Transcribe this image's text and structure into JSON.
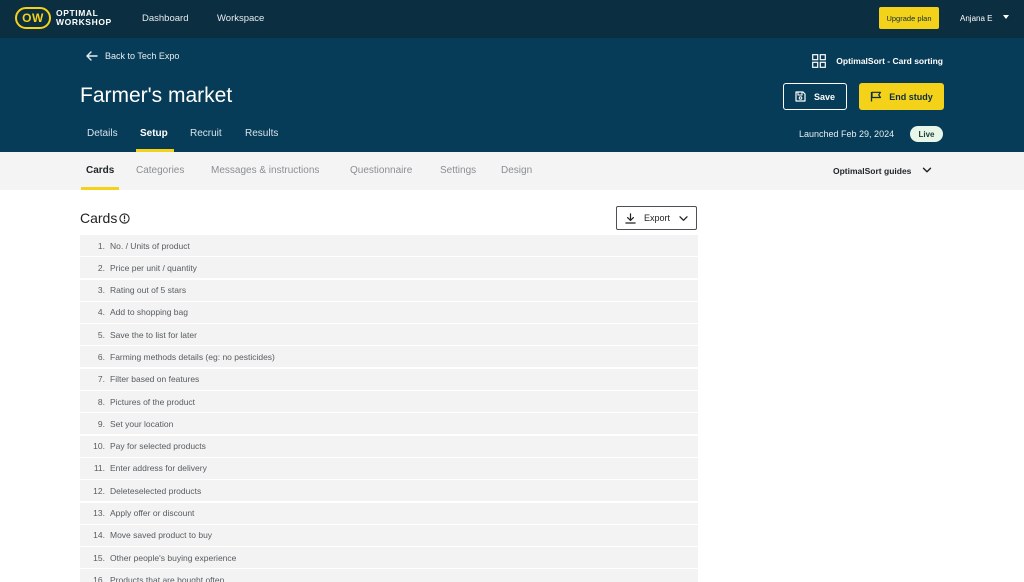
{
  "topbar": {
    "logo_mark": "OW",
    "logo_line1": "OPTIMAL",
    "logo_line2": "WORKSHOP",
    "nav": [
      "Dashboard",
      "Workspace"
    ],
    "upgrade_label": "Upgrade plan",
    "user_name": "Anjana E"
  },
  "header": {
    "back_label": "Back to Tech Expo",
    "study_type": "OptimalSort - Card sorting",
    "title": "Farmer's market",
    "save_label": "Save",
    "end_label": "End study",
    "tabs": [
      "Details",
      "Setup",
      "Recruit",
      "Results"
    ],
    "active_tab": "Setup",
    "launched": "Launched Feb 29, 2024",
    "status": "Live"
  },
  "subtabs": {
    "items": [
      "Cards",
      "Categories",
      "Messages & instructions",
      "Questionnaire",
      "Settings",
      "Design"
    ],
    "active": "Cards",
    "guides_label": "OptimalSort guides"
  },
  "cards": {
    "heading": "Cards",
    "export_label": "Export",
    "items": [
      {
        "num": "1.",
        "label": "No. / Units of product"
      },
      {
        "num": "2.",
        "label": "Price per unit / quantity"
      },
      {
        "num": "3.",
        "label": "Rating out of 5 stars"
      },
      {
        "num": "4.",
        "label": "Add to shopping bag"
      },
      {
        "num": "5.",
        "label": "Save the to list for later"
      },
      {
        "num": "6.",
        "label": "Farming methods details (eg: no pesticides)"
      },
      {
        "num": "7.",
        "label": "Filter based on features"
      },
      {
        "num": "8.",
        "label": "Pictures of the product"
      },
      {
        "num": "9.",
        "label": "Set your location"
      },
      {
        "num": "10.",
        "label": "Pay for selected products"
      },
      {
        "num": "11.",
        "label": "Enter address for delivery"
      },
      {
        "num": "12.",
        "label": "Deleteselected products"
      },
      {
        "num": "13.",
        "label": "Apply offer or discount"
      },
      {
        "num": "14.",
        "label": "Move saved product to buy"
      },
      {
        "num": "15.",
        "label": "Other people's buying experience"
      },
      {
        "num": "16.",
        "label": "Products that are bought often"
      }
    ]
  },
  "colors": {
    "topbar_bg": "#0b2e40",
    "header_bg": "#073c58",
    "accent": "#f5d21a"
  }
}
